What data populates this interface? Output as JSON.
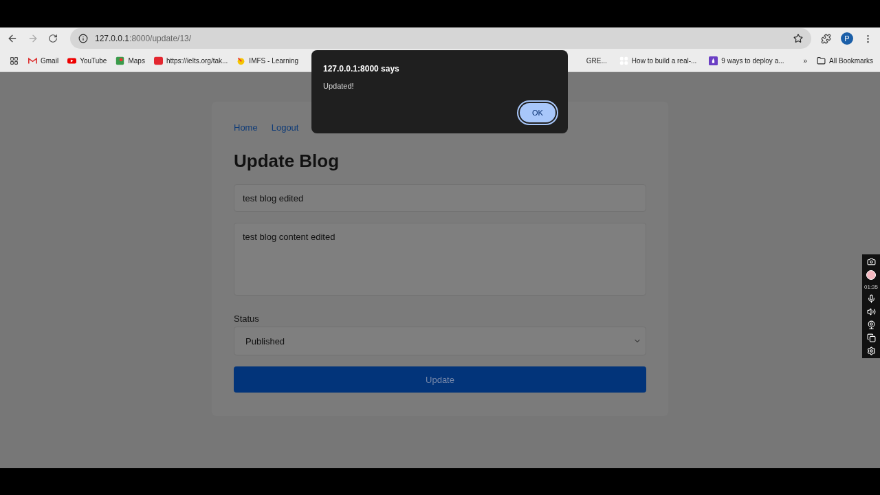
{
  "browser": {
    "url_host": "127.0.0.1",
    "url_path": ":8000/update/13/",
    "profile_initial": "P"
  },
  "bookmarks": [
    {
      "label": "Gmail",
      "kind": "gmail"
    },
    {
      "label": "YouTube",
      "kind": "youtube"
    },
    {
      "label": "Maps",
      "kind": "maps"
    },
    {
      "label": "https://ielts.org/tak...",
      "kind": "ielts"
    },
    {
      "label": "IMFS - Learning",
      "kind": "imfs"
    },
    {
      "label": "GRE...",
      "kind": "none"
    },
    {
      "label": "How to build a real-...",
      "kind": "tiles"
    },
    {
      "label": "9 ways to deploy a...",
      "kind": "rocket"
    }
  ],
  "bookmarks_more": "»",
  "all_bookmarks": "All Bookmarks",
  "nav": [
    "Home",
    "Logout"
  ],
  "form": {
    "title": "Update Blog",
    "title_value": "test blog edited",
    "content_value": "test blog content edited",
    "status_label": "Status",
    "status_value": "Published",
    "submit": "Update"
  },
  "dialog": {
    "title": "127.0.0.1:8000 says",
    "message": "Updated!",
    "button": "OK"
  },
  "recorder": {
    "time": "01:35"
  }
}
